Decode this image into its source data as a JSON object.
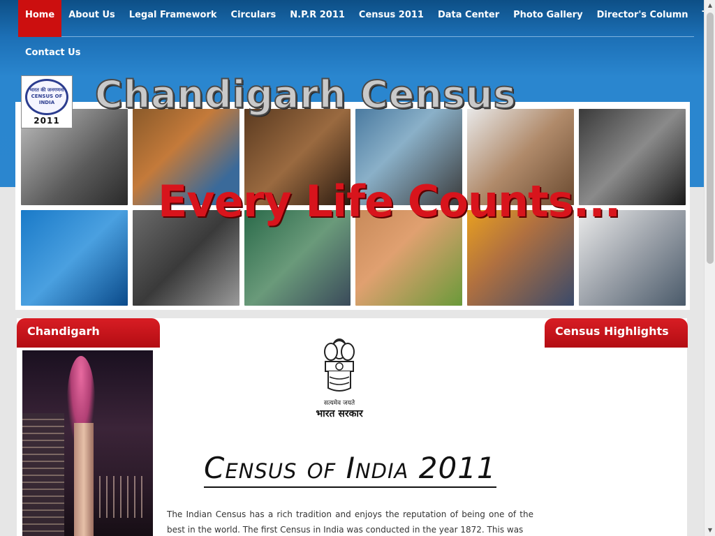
{
  "nav": {
    "row1": [
      "Home",
      "About Us",
      "Legal Framework",
      "Circulars",
      "N.P.R 2011",
      "Census 2011",
      "Data Center",
      "Photo Gallery",
      "Director's Column",
      "Tender"
    ],
    "row2": [
      "Contact Us"
    ],
    "active": "Home"
  },
  "banner": {
    "title": "Chandigarh Census",
    "tagline": "Every Life Counts...",
    "logo": {
      "text": "भारत की जनगणना CENSUS OF INDIA",
      "year": "2011"
    }
  },
  "sidebar_left": {
    "header": "Chandigarh Attractions"
  },
  "sidebar_right": {
    "header": "Census Highlights"
  },
  "main": {
    "emblem": {
      "motto": "सत्यमेव जयते",
      "govt": "भारत सरकार"
    },
    "heading": "Census of India 2011",
    "intro": "The Indian Census has a rich tradition and enjoys the reputation of being one of the best in the world. The first Census in India was conducted in the year 1872. This was"
  },
  "colors": {
    "nav_active": "#cc0f0f",
    "header_red": "#d81d24",
    "nav_bg": "#0d4f86"
  }
}
